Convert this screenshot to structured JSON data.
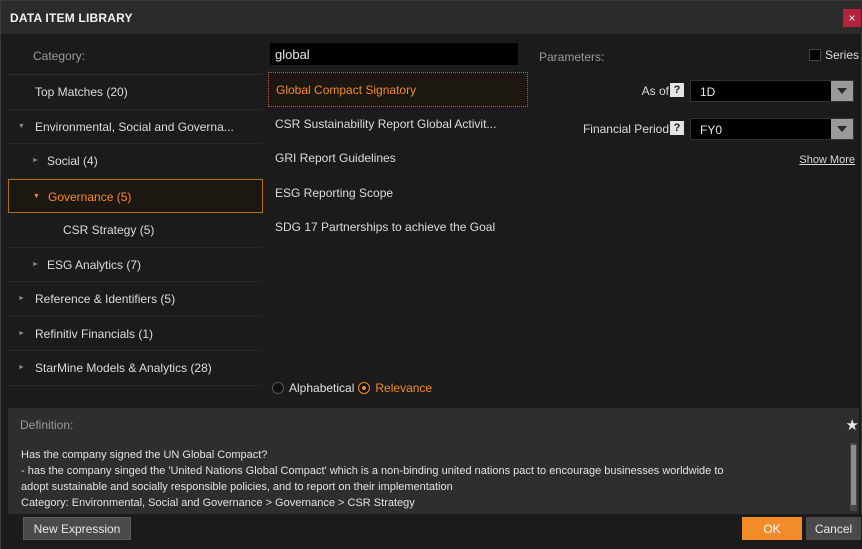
{
  "window": {
    "title": "DATA ITEM LIBRARY",
    "close_glyph": "×"
  },
  "category": {
    "header": "Category:",
    "items": [
      {
        "label": "Top Matches (20)"
      },
      {
        "label": "Environmental, Social and Governa...",
        "arrow": "▼"
      },
      {
        "label": "Social (4)",
        "arrow": "►"
      },
      {
        "label": "Governance (5)",
        "arrow": "▼"
      },
      {
        "label": "CSR Strategy (5)"
      },
      {
        "label": "ESG Analytics (7)",
        "arrow": "►"
      },
      {
        "label": "Reference & Identifiers (5)",
        "arrow": "►"
      },
      {
        "label": "Refinitiv Financials (1)",
        "arrow": "►"
      },
      {
        "label": "StarMine Models & Analytics (28)",
        "arrow": "►"
      }
    ]
  },
  "search": {
    "value": "global"
  },
  "results": {
    "items": [
      {
        "label": "Global Compact Signatory"
      },
      {
        "label": "CSR Sustainability Report Global Activit..."
      },
      {
        "label": "GRI Report Guidelines"
      },
      {
        "label": "ESG Reporting Scope"
      },
      {
        "label": "SDG 17 Partnerships to achieve the Goal"
      }
    ],
    "sort": {
      "alphabetical": "Alphabetical",
      "relevance": "Relevance"
    }
  },
  "parameters": {
    "header": "Parameters:",
    "series_label": "Series",
    "as_of": {
      "label": "As of",
      "help": "?",
      "value": "1D"
    },
    "financial_period": {
      "label": "Financial Period",
      "help": "?",
      "value": "FY0"
    },
    "show_more": "Show More"
  },
  "definition": {
    "header": "Definition:",
    "star_glyph": "★",
    "line1": "Has the company signed the UN Global Compact?",
    "line2": "- has the company singed the 'United Nations Global Compact' which is a non-binding united nations pact to encourage businesses worldwide to",
    "line3": "adopt sustainable and socially responsible policies, and to report on their implementation",
    "line4": "Category: Environmental, Social and Governance > Governance > CSR Strategy"
  },
  "footer": {
    "new_expression": "New Expression",
    "ok": "OK",
    "cancel": "Cancel"
  },
  "colors": {
    "accent": "#f28c28",
    "close": "#b3243a",
    "background": "#1b1b1b"
  }
}
